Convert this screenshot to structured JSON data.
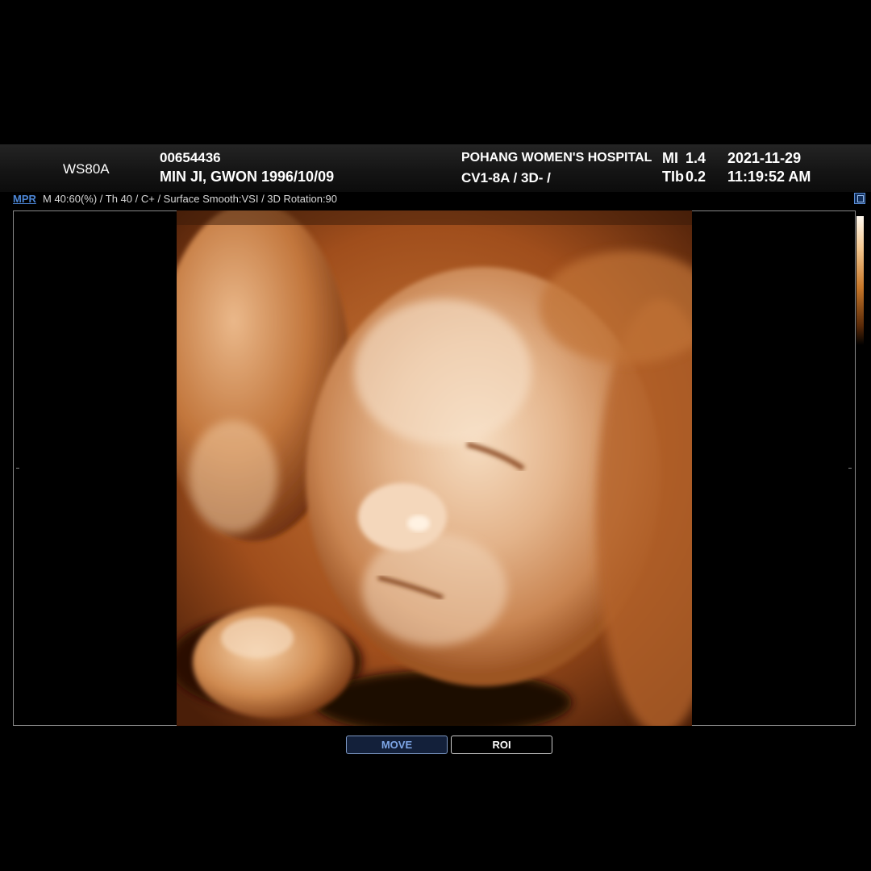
{
  "header": {
    "model": "WS80A",
    "patient_id": "00654436",
    "patient_name": "MIN JI, GWON 1996/10/09",
    "hospital": "POHANG WOMEN'S HOSPITAL",
    "probe": "CV1-8A / 3D- /",
    "mi_label": "MI",
    "mi_value": "1.4",
    "tib_label": "TIb",
    "tib_value": "0.2",
    "date": "2021-11-29",
    "time": "11:19:52 AM"
  },
  "info_bar": {
    "mode": "MPR",
    "params": "M 40:60(%) / Th 40 / C+ / Surface Smooth:VSI / 3D Rotation:90"
  },
  "viewport": {
    "render_palette": {
      "shadow": "#2a1005",
      "skin_dark": "#b8622a",
      "skin_mid": "#d9955e",
      "skin_light": "#f3d6b8"
    }
  },
  "buttons": {
    "move": "MOVE",
    "roi": "ROI"
  },
  "icons": {
    "save": "floppy-disk-icon"
  }
}
